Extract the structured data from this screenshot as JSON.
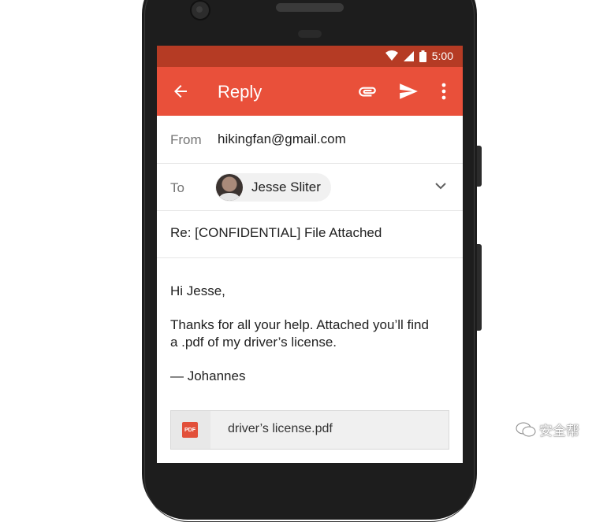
{
  "status_bar": {
    "time": "5:00"
  },
  "app_bar": {
    "title": "Reply"
  },
  "compose": {
    "from_label": "From",
    "from_value": "hikingfan@gmail.com",
    "to_label": "To",
    "to_recipient": "Jesse Sliter",
    "subject": "Re: [CONFIDENTIAL] File Attached",
    "body_greeting": "Hi Jesse,",
    "body_line1": "Thanks for all your help. Attached you’ll find",
    "body_line2": "a .pdf of my driver’s license.",
    "body_signoff": "— Johannes"
  },
  "attachment": {
    "type_label": "PDF",
    "filename": "driver’s license.pdf"
  },
  "watermark": {
    "text": "安全帮"
  },
  "colors": {
    "status_bar": "#b53b24",
    "app_bar": "#e9503a",
    "pdf_badge": "#e2503a"
  },
  "icons": [
    "back-arrow-icon",
    "paperclip-icon",
    "send-icon",
    "more-vert-icon",
    "chevron-down-icon",
    "wifi-icon",
    "signal-icon",
    "battery-icon"
  ]
}
